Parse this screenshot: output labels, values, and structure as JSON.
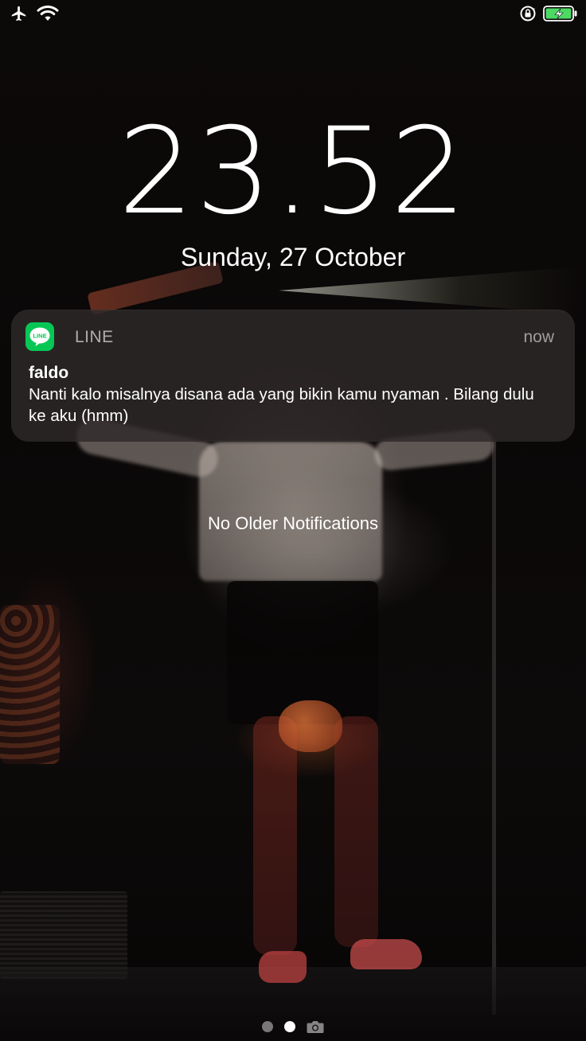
{
  "status_bar": {
    "left_icons": [
      "airplane-icon",
      "wifi-icon"
    ],
    "right_icons": [
      "orientation-lock-icon",
      "battery-charging-icon"
    ],
    "battery_color": "#4cd964"
  },
  "lock_screen": {
    "time": "23.52",
    "date": "Sunday, 27 October"
  },
  "notification": {
    "app_name": "LINE",
    "app_icon_text": "LINE",
    "app_icon_color": "#06c755",
    "time": "now",
    "sender": "faldo",
    "message": "Nanti kalo misalnya disana ada yang bikin kamu nyaman . Bilang dulu ke aku (hmm)"
  },
  "notification_center": {
    "empty_label": "No Older Notifications"
  },
  "page_indicator": {
    "pages": 2,
    "active_index": 1,
    "extra_icon": "camera-icon"
  }
}
